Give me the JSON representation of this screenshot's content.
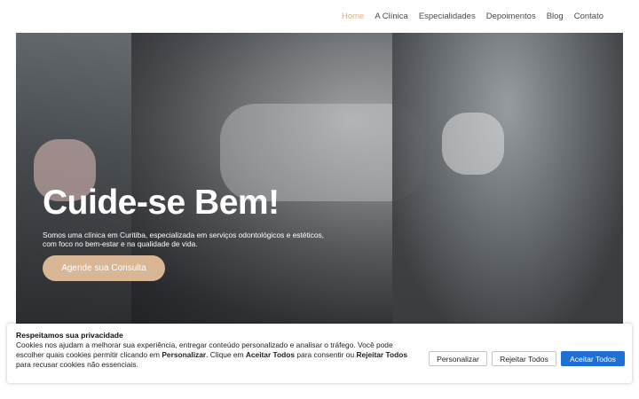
{
  "nav": {
    "items": [
      "Home",
      "A Clínica",
      "Especialidades",
      "Depoimentos",
      "Blog",
      "Contato"
    ],
    "active_color": "#d4b08c"
  },
  "hero": {
    "title": "Cuide-se Bem!",
    "subtitle": "Somos uma clínica em Curitiba, especializada em serviços odontológicos e estéticos, com foco no bem-estar e na qualidade de vida.",
    "cta_label": "Agende sua Consulta",
    "cta_color": "#d8b696"
  },
  "cookie": {
    "title": "Respeitamos sua privacidade",
    "text_1": "Cookies nos ajudam a melhorar sua experiência, entregar conteúdo personalizado e analisar o tráfego. Você pode escolher quais cookies permitir clicando em ",
    "bold_1": "Personalizar",
    "text_2": ". Clique em ",
    "bold_2": "Aceitar Todos",
    "text_3": " para consentir ou ",
    "bold_3": "Rejeitar Todos",
    "text_4": " para recusar cookies não essenciais.",
    "buttons": {
      "customize": "Personalizar",
      "reject_all": "Rejeitar Todos",
      "accept_all": "Aceitar Todos"
    },
    "accept_color": "#1f6fd4"
  }
}
